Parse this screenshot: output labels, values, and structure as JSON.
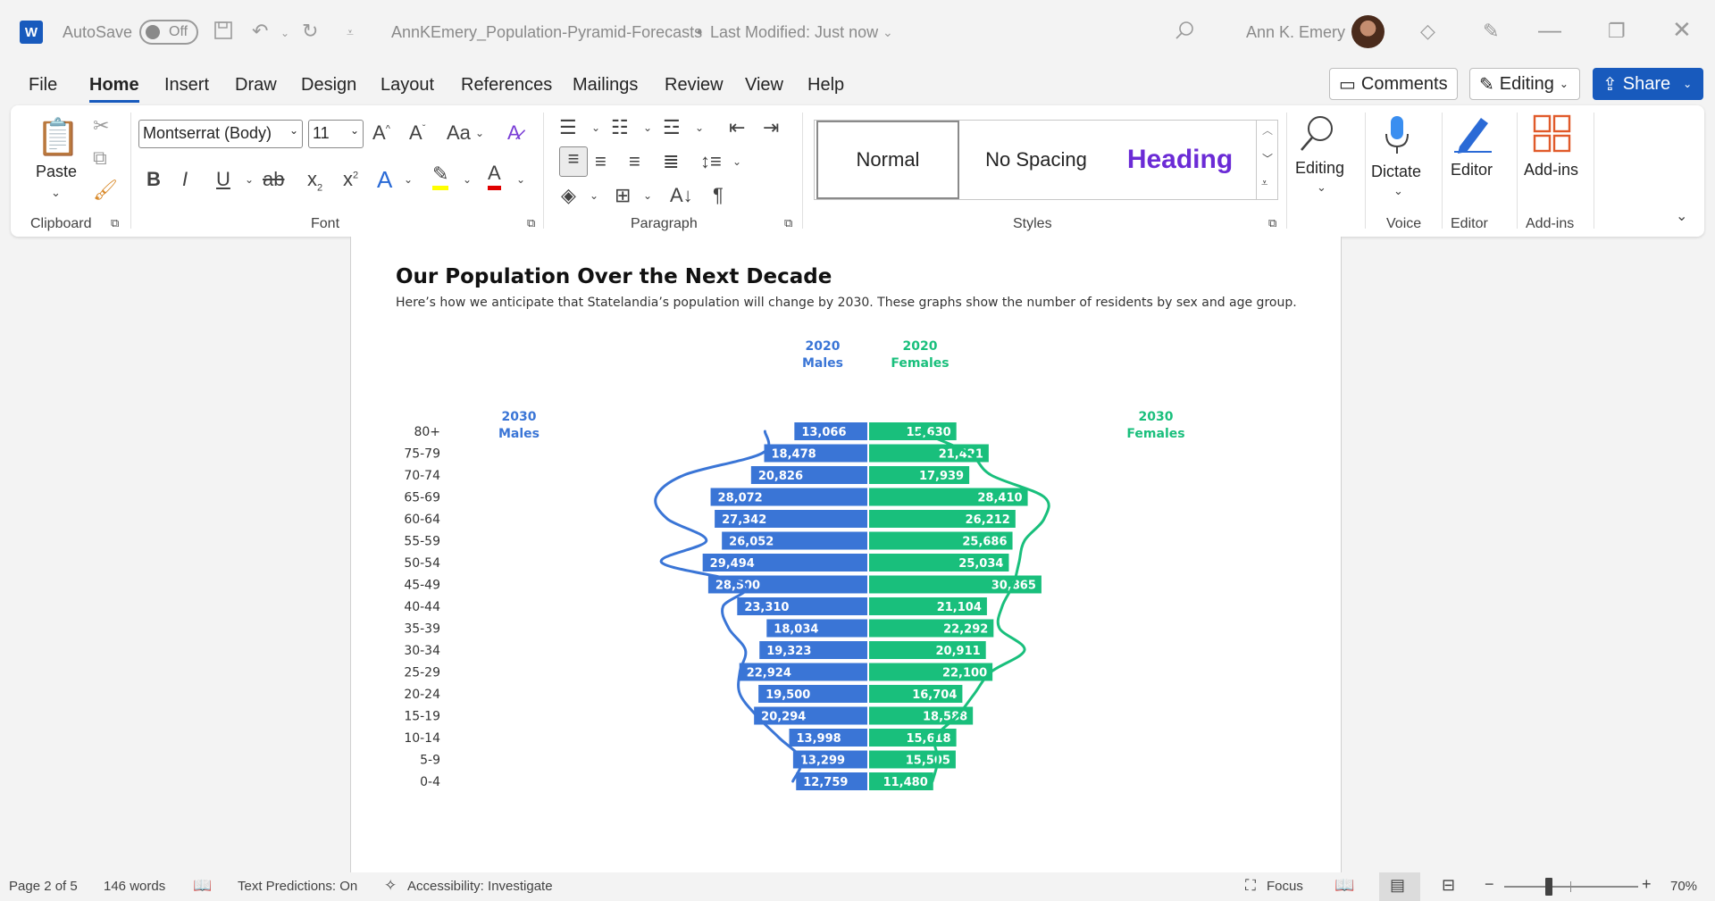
{
  "titlebar": {
    "autosave_label": "AutoSave",
    "autosave_state": "Off",
    "doc_title": "AnnKEmery_Population-Pyramid-Forecasts",
    "separator": "•",
    "last_modified": "Last Modified: Just now",
    "user_name": "Ann K. Emery"
  },
  "menu": {
    "tabs": [
      "File",
      "Home",
      "Insert",
      "Draw",
      "Design",
      "Layout",
      "References",
      "Mailings",
      "Review",
      "View",
      "Help"
    ],
    "comments_label": "Comments",
    "editing_label": "Editing",
    "share_label": "Share"
  },
  "ribbon": {
    "paste_label": "Paste",
    "font_name": "Montserrat (Body)",
    "font_size": "11",
    "styles": {
      "normal": "Normal",
      "no_spacing": "No Spacing",
      "heading": "Heading"
    },
    "editing_label": "Editing",
    "dictate_label": "Dictate",
    "editor_label": "Editor",
    "addins_label": "Add-ins",
    "groups": {
      "clipboard": "Clipboard",
      "font": "Font",
      "paragraph": "Paragraph",
      "styles": "Styles",
      "voice": "Voice",
      "editor": "Editor",
      "addins": "Add-ins"
    },
    "colors": {
      "accent": "#185abd",
      "heading_style": "#6b2bd6",
      "highlight": "#ffff00",
      "font_color": "#e00000"
    }
  },
  "document": {
    "title": "Our Population Over the Next Decade",
    "subtitle": "Here’s how we anticipate that Statelandia’s population will change by 2030. These graphs show the number of residents by sex and age group."
  },
  "chart_data": {
    "type": "bar",
    "categories": [
      "80+",
      "75-79",
      "70-74",
      "65-69",
      "60-64",
      "55-59",
      "50-54",
      "45-49",
      "40-44",
      "35-39",
      "30-34",
      "25-29",
      "20-24",
      "15-19",
      "10-14",
      "5-9",
      "0-4"
    ],
    "series": [
      {
        "name": "2020 Males",
        "color": "#3a75d6",
        "values": [
          13066,
          18478,
          20826,
          28072,
          27342,
          26052,
          29494,
          28500,
          23310,
          18034,
          19323,
          22924,
          19500,
          20294,
          13998,
          13299,
          12759
        ]
      },
      {
        "name": "2020 Females",
        "color": "#19bf7c",
        "values": [
          15630,
          21421,
          17939,
          28410,
          26212,
          25686,
          25034,
          30865,
          21104,
          22292,
          20911,
          22100,
          16704,
          18588,
          15618,
          15505,
          11480
        ]
      }
    ],
    "value_labels": {
      "males": [
        "13,066",
        "18,478",
        "20,826",
        "28,072",
        "27,342",
        "26,052",
        "29,494",
        "28,500",
        "23,310",
        "18,034",
        "19,323",
        "22,924",
        "19,500",
        "20,294",
        "13,998",
        "13,299",
        "12,759"
      ],
      "females": [
        "15,630",
        "21,421",
        "17,939",
        "28,410",
        "26,212",
        "25,686",
        "25,034",
        "30,865",
        "21,104",
        "22,292",
        "20,911",
        "22,100",
        "16,704",
        "18,588",
        "15,618",
        "15,505",
        "11,480"
      ]
    },
    "header_labels": {
      "males_year": "2020",
      "males_label": "Males",
      "females_year": "2020",
      "females_label": "Females"
    },
    "forecast_labels": {
      "males_year": "2030",
      "males_label": "Males",
      "females_year": "2030",
      "females_label": "Females"
    },
    "forecast_2030_males_approx": [
      18500,
      19000,
      33000,
      38000,
      36000,
      29000,
      37000,
      22000,
      26000,
      25000,
      22000,
      23000,
      23000,
      20000,
      16000,
      12000,
      13500
    ],
    "forecast_2030_females_approx": [
      9000,
      18000,
      22000,
      31500,
      31500,
      28000,
      27000,
      26000,
      24000,
      23500,
      28000,
      22000,
      19000,
      16000,
      12000,
      12500,
      11500
    ],
    "xlim": [
      0,
      42000
    ]
  },
  "statusbar": {
    "page": "Page 2 of 5",
    "words": "146 words",
    "text_predictions": "Text Predictions: On",
    "accessibility": "Accessibility: Investigate",
    "focus": "Focus",
    "zoom_minus": "−",
    "zoom_plus": "+",
    "zoom": "70%"
  }
}
